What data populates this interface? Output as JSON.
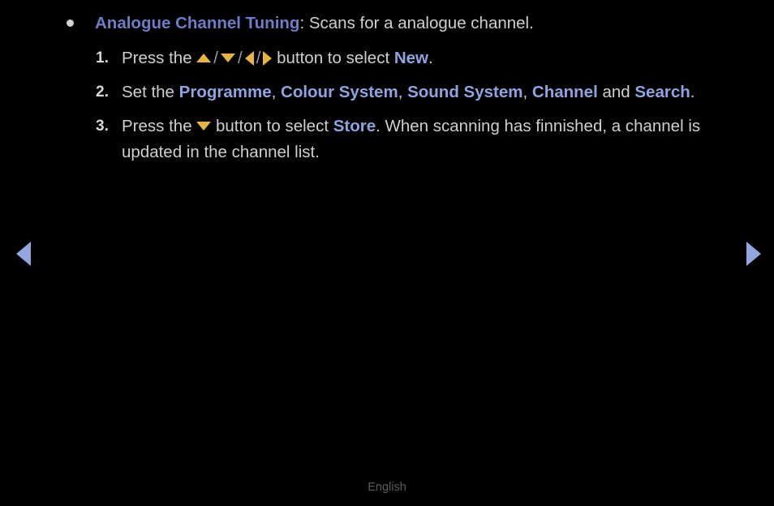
{
  "page": {
    "background_color": "#000000",
    "body_text_color": "#cfcfcf",
    "heading_term_color": "#6d7ec7",
    "keyword_color": "#8fa3e0",
    "dpad_icon_color": "#e8b33e",
    "nav_arrow_color": "#94a6e0"
  },
  "bullet": {
    "term": "Analogue Channel Tuning",
    "separator": ": ",
    "description": "Scans for a analogue channel."
  },
  "steps": [
    {
      "number": "1.",
      "segments": [
        {
          "type": "text",
          "value": "Press the "
        },
        {
          "type": "icon",
          "icon": "triangle-up-icon"
        },
        {
          "type": "sep",
          "value": "/"
        },
        {
          "type": "icon",
          "icon": "triangle-down-icon"
        },
        {
          "type": "sep",
          "value": "/"
        },
        {
          "type": "icon",
          "icon": "triangle-left-icon"
        },
        {
          "type": "sep",
          "value": "/"
        },
        {
          "type": "icon",
          "icon": "triangle-right-icon"
        },
        {
          "type": "text",
          "value": " button to select "
        },
        {
          "type": "keyword",
          "value": "New"
        },
        {
          "type": "text",
          "value": "."
        }
      ]
    },
    {
      "number": "2.",
      "segments": [
        {
          "type": "text",
          "value": "Set the "
        },
        {
          "type": "keyword",
          "value": "Programme"
        },
        {
          "type": "text",
          "value": ", "
        },
        {
          "type": "keyword",
          "value": "Colour System"
        },
        {
          "type": "text",
          "value": ", "
        },
        {
          "type": "keyword",
          "value": "Sound System"
        },
        {
          "type": "text",
          "value": ", "
        },
        {
          "type": "keyword",
          "value": "Channel"
        },
        {
          "type": "text",
          "value": " and "
        },
        {
          "type": "keyword",
          "value": "Search"
        },
        {
          "type": "text",
          "value": "."
        }
      ]
    },
    {
      "number": "3.",
      "segments": [
        {
          "type": "text",
          "value": "Press the "
        },
        {
          "type": "icon",
          "icon": "triangle-down-icon"
        },
        {
          "type": "text",
          "value": " button to select "
        },
        {
          "type": "keyword",
          "value": "Store"
        },
        {
          "type": "text",
          "value": ". When scanning has finnished, a channel is updated in the channel list."
        }
      ]
    }
  ],
  "navigation": {
    "prev_icon": "triangle-left-icon",
    "next_icon": "triangle-right-icon"
  },
  "footer": {
    "language": "English"
  }
}
